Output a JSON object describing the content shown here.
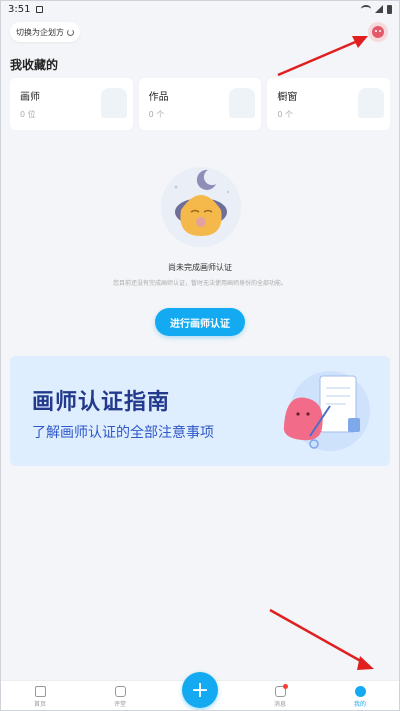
{
  "status": {
    "time": "3:51"
  },
  "header": {
    "switch_label": "切换为企划方"
  },
  "favorites": {
    "title": "我收藏的",
    "cards": [
      {
        "title": "画师",
        "count": "0 位"
      },
      {
        "title": "作品",
        "count": "0 个"
      },
      {
        "title": "橱窗",
        "count": "0 个"
      }
    ]
  },
  "empty": {
    "title": "尚未完成画师认证",
    "subtitle": "您目前还没有完成画师认证，暂时无法使用画师身份的全部功能。",
    "button": "进行画师认证"
  },
  "guide": {
    "title": "画师认证指南",
    "subtitle": "了解画师认证的全部注意事项"
  },
  "tabbar": {
    "tabs": [
      {
        "label": "首页"
      },
      {
        "label": "评堂"
      },
      {
        "label": "消息"
      },
      {
        "label": "我的"
      }
    ],
    "fab_symbol": "+"
  },
  "colors": {
    "accent": "#14aaf2",
    "guide_bg": "#dfeeff",
    "guide_title": "#233a8c",
    "arrow": "#e02020"
  }
}
